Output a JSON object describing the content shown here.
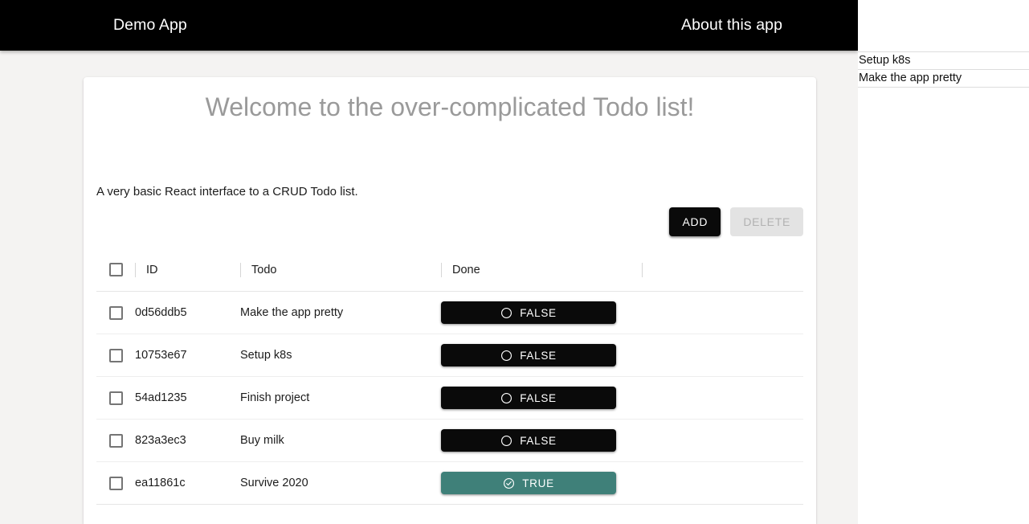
{
  "appbar": {
    "title": "Demo App",
    "about_label": "About this app"
  },
  "card": {
    "title": "Welcome to the over-complicated Todo list!",
    "subtitle": "A very basic React interface to a CRUD Todo list."
  },
  "actions": {
    "add_label": "ADD",
    "delete_label": "DELETE"
  },
  "table": {
    "columns": [
      {
        "key": "check",
        "label": ""
      },
      {
        "key": "id",
        "label": "ID"
      },
      {
        "key": "todo",
        "label": "Todo"
      },
      {
        "key": "done",
        "label": "Done"
      },
      {
        "key": "extra",
        "label": ""
      }
    ],
    "rows": [
      {
        "id": "0d56ddb5",
        "todo": "Make the app pretty",
        "done_label": "FALSE",
        "done": false
      },
      {
        "id": "10753e67",
        "todo": "Setup k8s",
        "done_label": "FALSE",
        "done": false
      },
      {
        "id": "54ad1235",
        "todo": "Finish project",
        "done_label": "FALSE",
        "done": false
      },
      {
        "id": "823a3ec3",
        "todo": "Buy milk",
        "done_label": "FALSE",
        "done": false
      },
      {
        "id": "ea11861c",
        "todo": "Survive 2020",
        "done_label": "TRUE",
        "done": true
      }
    ]
  },
  "right_panel": {
    "items": [
      {
        "label": "Setup k8s"
      },
      {
        "label": "Make the app pretty"
      }
    ]
  },
  "colors": {
    "appbar_background": "#000000",
    "page_background": "#f4f3f2",
    "card_background": "#ffffff",
    "add_button": "#0a0a0a",
    "delete_button": "#e3e3e3",
    "delete_label_color": "#b2b2b2",
    "done_false": "#0a0a0a",
    "done_true": "#3f8079",
    "title_color": "#9a9a9a"
  },
  "icons": {
    "checkbox": "checkbox-unchecked-icon",
    "done_false": "circle-outline-icon",
    "done_true": "check-circle-icon"
  }
}
